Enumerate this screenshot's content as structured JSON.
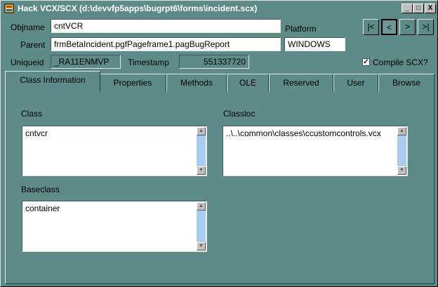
{
  "window": {
    "title": "Hack VCX/SCX (d:\\devvfp5apps\\bugrpt6\\forms\\incident.scx)"
  },
  "titlebar": {
    "minimize_glyph": "_",
    "maximize_glyph": "□",
    "close_glyph": "X"
  },
  "header": {
    "objname_label": "Objname",
    "objname_value": "cntVCR",
    "parent_label": "Parent",
    "parent_value": "frmBetaIncident.pgfPageframe1.pagBugReport",
    "uniqueid_label": "Uniqueid",
    "uniqueid_value": "_RA11ENMVP",
    "timestamp_label": "Timestamp",
    "timestamp_value": "551337720",
    "platform_label": "Platform",
    "platform_value": "WINDOWS",
    "compile_label": "Compile SCX?",
    "compile_checked": "✓"
  },
  "nav": {
    "first": "|<",
    "prev": "<",
    "next": ">",
    "last": ">|"
  },
  "tabs": [
    {
      "label": "Class Information"
    },
    {
      "label": "Properties"
    },
    {
      "label": "Methods"
    },
    {
      "label": "OLE"
    },
    {
      "label": "Reserved"
    },
    {
      "label": "User"
    },
    {
      "label": "Browse"
    }
  ],
  "class_info": {
    "class_label": "Class",
    "class_value": "cntvcr",
    "classloc_label": "Classloc",
    "classloc_value": "..\\..\\common\\classes\\ccustomcontrols.vcx",
    "baseclass_label": "Baseclass",
    "baseclass_value": "container"
  },
  "colors": {
    "background": "#5f8a8a",
    "field": "#ffffff",
    "scrollbar": "#aaccf0"
  }
}
